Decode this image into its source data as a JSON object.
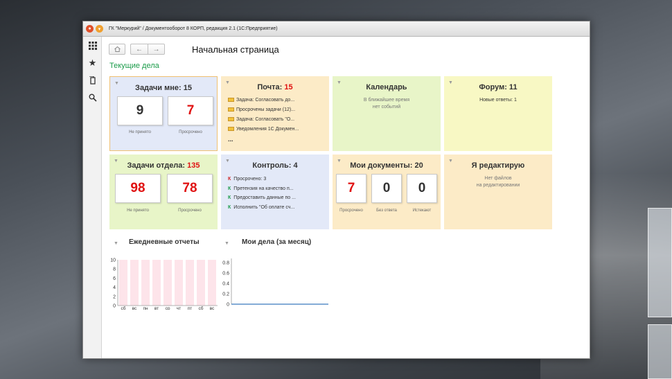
{
  "window": {
    "title": "ГК \"Меркурий\" / Документооборот 8 КОРП, редакция 2.1  (1С:Предприятие)"
  },
  "page": {
    "title": "Начальная страница",
    "section_title": "Текущие дела"
  },
  "icons": {
    "home": "home-icon",
    "back": "arrow-left-icon",
    "forward": "arrow-right-icon",
    "apps": "apps-grid-icon",
    "favorites": "star-icon",
    "history": "history-icon",
    "search": "search-icon"
  },
  "tiles": {
    "my_tasks": {
      "title": "Задачи мне: 15",
      "not_accepted_value": "9",
      "not_accepted_label": "Не принято",
      "overdue_value": "7",
      "overdue_label": "Просрочено"
    },
    "mail": {
      "title_prefix": "Почта: ",
      "title_count": "15",
      "items": [
        "Задача: Согласовать до...",
        "Просрочены задачи (12)...",
        "Задача: Согласовать \"О...",
        "Уведомления 1С Докумен..."
      ],
      "more": "..."
    },
    "calendar": {
      "title": "Календарь",
      "line1": "В ближайшее время",
      "line2": "нет событий"
    },
    "forum": {
      "title": "Форум: 11",
      "subtitle": "Новые ответы: 1"
    },
    "dept_tasks": {
      "title_prefix": "Задачи отдела: ",
      "title_count": "135",
      "not_accepted_value": "98",
      "not_accepted_label": "Не принято",
      "overdue_value": "78",
      "overdue_label": "Просрочено"
    },
    "control": {
      "title": "Контроль: 4",
      "items": [
        {
          "marker": "К",
          "text": "Просрочено: 3"
        },
        {
          "marker": "К",
          "text": "Претензия на качество п..."
        },
        {
          "marker": "К",
          "text": "Предоставить данные по ..."
        },
        {
          "marker": "К",
          "text": "Исполнить \"Об оплате сч..."
        }
      ]
    },
    "my_documents": {
      "title": "Мои документы: 20",
      "overdue_value": "7",
      "overdue_label": "Просрочено",
      "no_answer_value": "0",
      "no_answer_label": "Без ответа",
      "expiring_value": "0",
      "expiring_label": "Истекают"
    },
    "editing": {
      "title": "Я редактирую",
      "line1": "Нет файлов",
      "line2": "на редактировании"
    }
  },
  "reports": {
    "daily_title": "Ежедневные отчеты",
    "monthly_title": "Мои дела (за месяц)"
  },
  "chart_data": [
    {
      "type": "bar",
      "categories": [
        "сб",
        "вс",
        "пн",
        "вт",
        "ср",
        "чт",
        "пт",
        "сб",
        "вс"
      ],
      "values": [
        0,
        0,
        0,
        0,
        0,
        0,
        0,
        0,
        0
      ],
      "yticks": [
        "10",
        "8",
        "6",
        "4",
        "2",
        "0"
      ],
      "ylim": [
        0,
        10
      ],
      "bar_color": "#fde4ea"
    },
    {
      "type": "line",
      "x": [
        0,
        1,
        2,
        3,
        4,
        5,
        6,
        7,
        8,
        9,
        10,
        11,
        12,
        13,
        14,
        15,
        16,
        17,
        18,
        19,
        20,
        21,
        22,
        23,
        24,
        25,
        26,
        27,
        28,
        29
      ],
      "values": [
        0,
        0,
        0,
        0,
        0,
        0,
        0,
        0,
        0,
        0,
        0,
        0,
        0,
        0,
        0,
        0,
        0,
        0,
        0,
        0,
        0,
        0,
        0,
        0,
        0,
        0,
        0,
        0,
        0,
        0
      ],
      "yticks": [
        "0.8",
        "0.6",
        "0.4",
        "0.2",
        "0"
      ],
      "ylim": [
        0,
        0.8
      ],
      "line_color": "#5a8fc8"
    }
  ],
  "colors": {
    "tile_blue": "#e3e9f8",
    "tile_orange": "#fcebc7",
    "tile_green": "#e8f5c8",
    "tile_yellow": "#f8f8c4",
    "accent_green": "#1a9b49",
    "accent_red": "#e01010"
  }
}
